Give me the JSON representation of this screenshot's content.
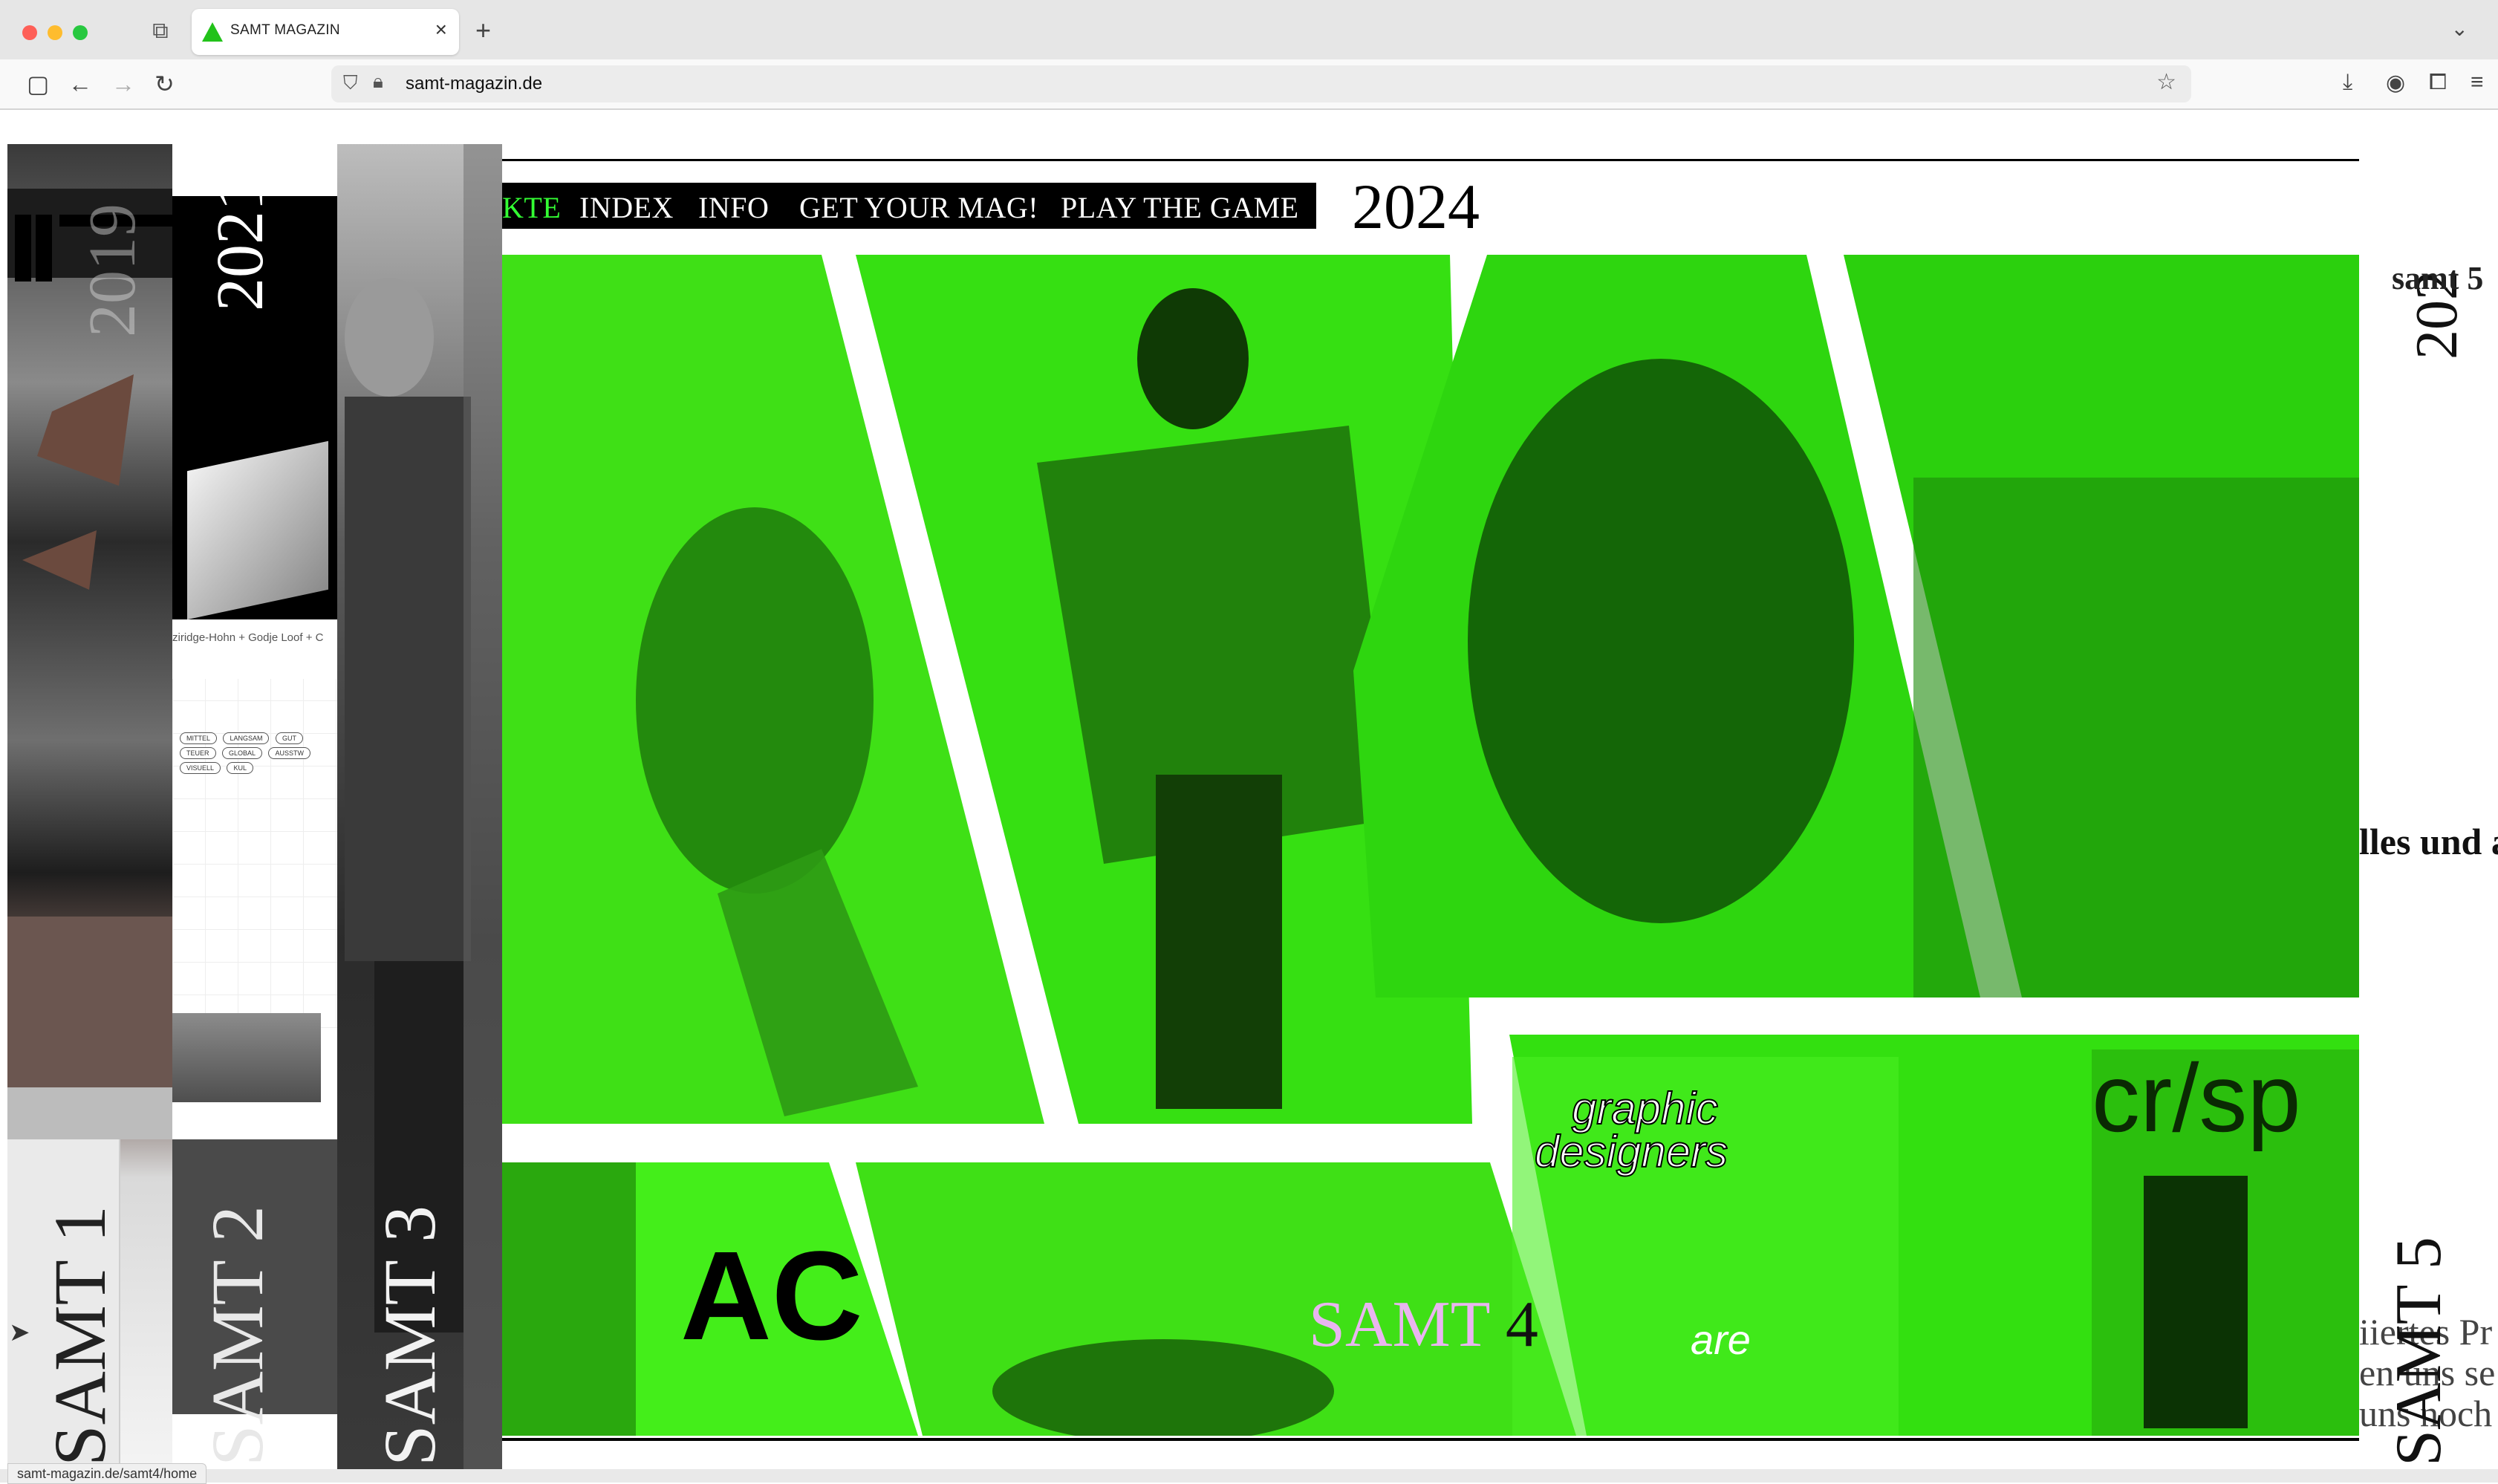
{
  "browser": {
    "tab_title": "SAMT MAGAZIN",
    "url": "samt-magazin.de",
    "status_url": "samt-magazin.de/samt4/home",
    "tab_close": "×",
    "new_tab": "+",
    "tab_list": "⌄",
    "accent": "#22c21a"
  },
  "nav": {
    "items": [
      "KTE",
      "INDEX",
      "INFO",
      "GET YOUR MAG!",
      "PLAY THE GAME"
    ],
    "year": "2024"
  },
  "issues_left": {
    "year_2019": "2019",
    "year_2021": "2021",
    "credit": "ziridge-Hohn + Godje Loof + C",
    "pills": [
      "MITTEL",
      "LANGSAM",
      "GUT",
      "TEUER",
      "GLOBAL",
      "AUSSTW",
      "VISUELL",
      "KUL"
    ],
    "samt1": "SAMT 1",
    "samt2": "SAMT 2",
    "samt3": "SAMT 3"
  },
  "main": {
    "samt4_a": "SAMT",
    "samt4_b": "4",
    "poster_text_1": "graphic",
    "poster_text_2": "designers",
    "poster_are": "are",
    "poster_crisp": "cr/sp",
    "poster_ac": "AC",
    "accent_green": "#3af012"
  },
  "issues_right": {
    "year": "202",
    "samt5_top": "samt 5",
    "text_1": "lles und a",
    "text_2": "iiertes Pr",
    "text_3": "en uns se",
    "text_4": "uns noch",
    "samt5": "SAMT 5"
  }
}
